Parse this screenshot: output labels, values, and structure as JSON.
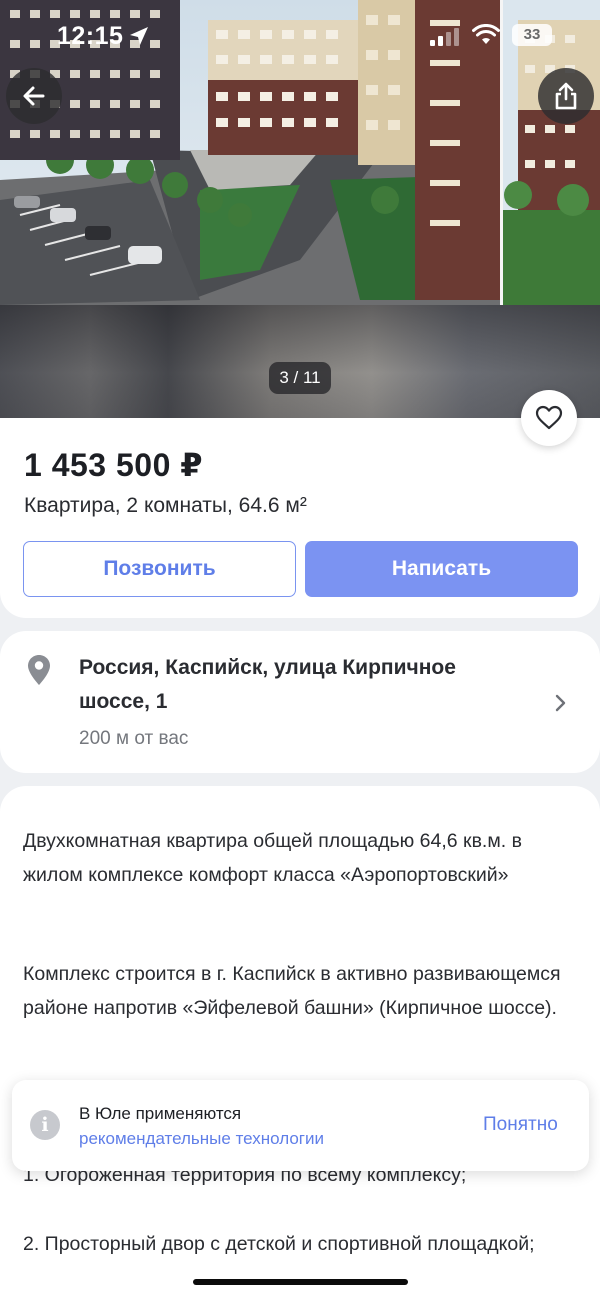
{
  "status_bar": {
    "time": "12:15",
    "battery": "33"
  },
  "gallery": {
    "counter": "3 / 11"
  },
  "listing": {
    "price": "1 453 500 ₽",
    "subtitle": "Квартира, 2 комнаты, 64.6 м²",
    "call_label": "Позвонить",
    "write_label": "Написать"
  },
  "address": {
    "line1": "Россия, Каспийск, улица Кирпичное",
    "line2": "шоссе, 1",
    "distance": "200 м от вас"
  },
  "description": {
    "p1": "Двухкомнатная квартира общей площадью 64,6 кв.м. в жилом комплексе комфорт класса «Аэропортовский»",
    "p2": "Комплекс строится в г. Каспийск в активно развивающемся районе напротив «Эйфелевой башни» (Кирпичное шоссе).",
    "p3": "1. Огороженная территория по всему комплексу;",
    "p4": "2. Просторный двор с детской и спортивной площадкой;"
  },
  "toast": {
    "title": "В Юле применяются",
    "link": "рекомендательные технологии",
    "ok": "Понятно"
  },
  "colors": {
    "accent": "#7b93f2",
    "link": "#5f7ee8",
    "background": "#eef0f3"
  },
  "icons": [
    "back-arrow-icon",
    "share-icon",
    "heart-icon",
    "location-pin-icon",
    "chevron-right-icon",
    "info-icon"
  ]
}
